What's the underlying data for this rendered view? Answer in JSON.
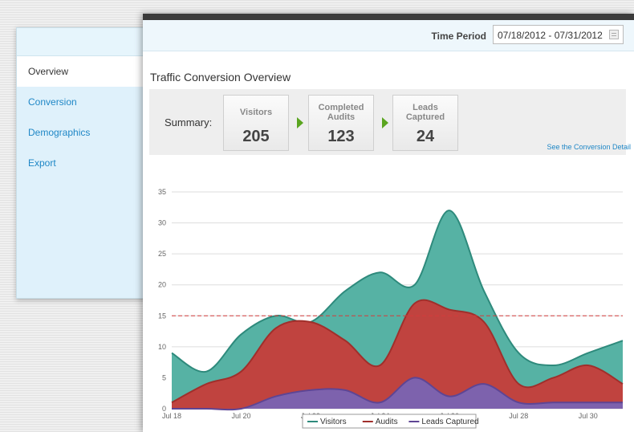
{
  "sidebar": {
    "items": [
      {
        "label": "Overview",
        "active": true
      },
      {
        "label": "Conversion",
        "active": false
      },
      {
        "label": "Demographics",
        "active": false
      },
      {
        "label": "Export",
        "active": false
      }
    ]
  },
  "header": {
    "time_period_label": "Time Period",
    "date_range": "07/18/2012 - 07/31/2012",
    "calendar_icon": "calendar-icon"
  },
  "main": {
    "section_title": "Traffic Conversion Overview",
    "summary": {
      "label": "Summary:",
      "cards": [
        {
          "label": "Visitors",
          "value": "205"
        },
        {
          "label": "Completed Audits",
          "value": "123"
        },
        {
          "label": "Leads Captured",
          "value": "24"
        }
      ],
      "detail_link": "See the Conversion Detail"
    }
  },
  "colors": {
    "visitors": "#56b2a4",
    "visitors_line": "#2e8a7c",
    "audits": "#c0433f",
    "audits_line": "#a02f2b",
    "leads": "#7d62ad",
    "leads_line": "#5e4594",
    "threshold": "#d33c3c",
    "grid": "#dddddd",
    "link": "#1f87c6",
    "arrow": "#5aa520"
  },
  "chart_data": {
    "type": "area",
    "categories": [
      "Jul 18",
      "Jul 19",
      "Jul 20",
      "Jul 21",
      "Jul 22",
      "Jul 23",
      "Jul 24",
      "Jul 25",
      "Jul 26",
      "Jul 27",
      "Jul 28",
      "Jul 29",
      "Jul 30",
      "Jul 31"
    ],
    "x_tick_labels": [
      "Jul 18",
      "Jul 20",
      "Jul 22",
      "Jul 24",
      "Jul 26",
      "Jul 28",
      "Jul 30"
    ],
    "series": [
      {
        "name": "Visitors",
        "values": [
          9,
          6,
          12,
          15,
          14,
          19,
          22,
          20,
          32,
          19,
          9,
          7,
          9,
          11
        ]
      },
      {
        "name": "Audits",
        "values": [
          1,
          4,
          6,
          13,
          14,
          11,
          7,
          17,
          16,
          14,
          4,
          5,
          7,
          4
        ]
      },
      {
        "name": "Leads Captured",
        "values": [
          0,
          0,
          0,
          2,
          3,
          3,
          1,
          5,
          2,
          4,
          1,
          1,
          1,
          1
        ]
      }
    ],
    "threshold": 15,
    "ylim": [
      0,
      35
    ],
    "yticks": [
      "0",
      "5",
      "10",
      "15",
      "20",
      "25",
      "30",
      "35"
    ],
    "grid": true,
    "legend": "bottom"
  }
}
